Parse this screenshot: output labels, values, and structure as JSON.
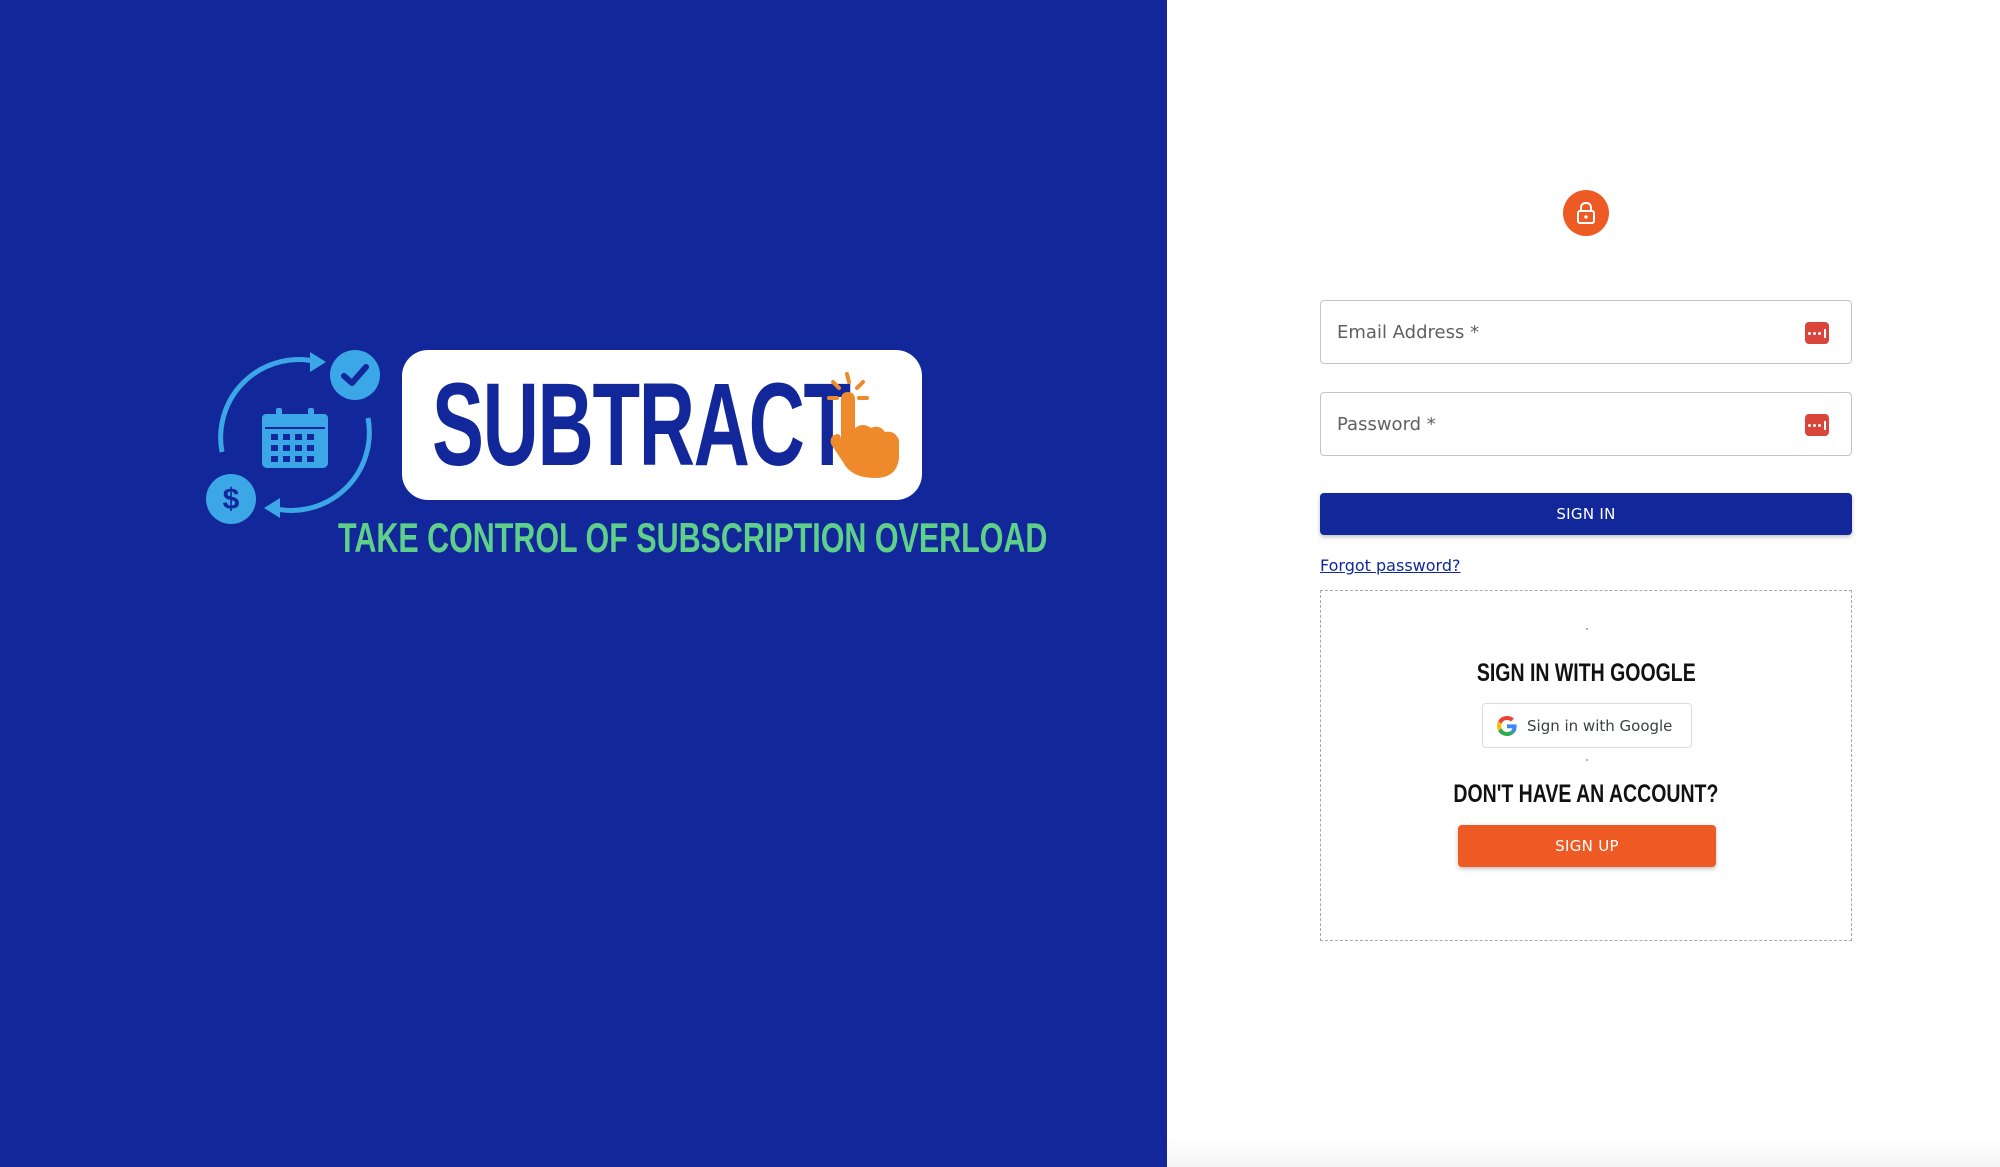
{
  "brand": {
    "name": "SUBTRACT",
    "tagline": "TAKE CONTROL OF SUBSCRIPTION OVERLOAD",
    "colors": {
      "primary": "#12289a",
      "accent": "#ee5a24",
      "tagline": "#5fd08a",
      "cycle_icon": "#3ba7e6"
    }
  },
  "icons": {
    "lock": "lock-icon",
    "calendar": "calendar-icon",
    "dollar": "dollar-icon",
    "checkmark": "checkmark-icon",
    "pointer_hand": "pointer-hand-icon",
    "password_manager": "password-manager-key-icon",
    "google": "google-g-icon"
  },
  "login_form": {
    "email_placeholder": "Email Address *",
    "email_value": "",
    "password_placeholder": "Password *",
    "password_value": "",
    "signin_label": "SIGN IN",
    "forgot_label": "Forgot password?"
  },
  "alternatives": {
    "google_heading": "SIGN IN WITH GOOGLE",
    "google_button_label": "Sign in with Google",
    "signup_heading": "DON'T HAVE AN ACCOUNT?",
    "signup_label": "SIGN UP"
  }
}
